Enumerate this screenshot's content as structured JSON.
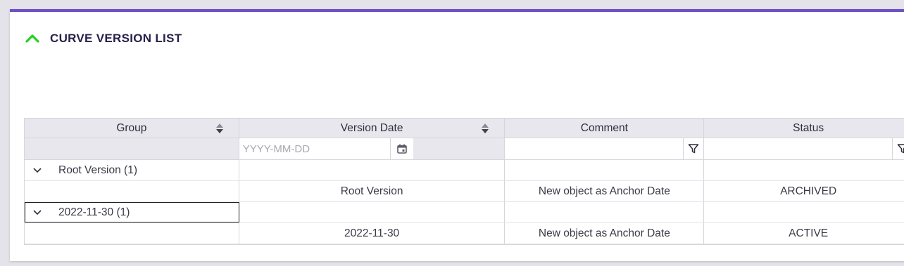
{
  "panel": {
    "title": "CURVE VERSION LIST",
    "accent_color": "#6f4fc7",
    "collapse_icon_color": "#22d21f"
  },
  "grid": {
    "columns": [
      {
        "label": "Group",
        "sortable": true
      },
      {
        "label": "Version Date",
        "sortable": true
      },
      {
        "label": "Comment",
        "sortable": false
      },
      {
        "label": "Status",
        "sortable": false
      }
    ],
    "filters": {
      "version_date_placeholder": "YYYY-MM-DD",
      "version_date_value": "",
      "comment_value": "",
      "status_value": ""
    },
    "groups": [
      {
        "label": "Root Version (1)",
        "expanded": true,
        "rows": [
          {
            "version_date": "Root Version",
            "comment": "New object as Anchor Date",
            "status": "ARCHIVED"
          }
        ]
      },
      {
        "label": "2022-11-30 (1)",
        "expanded": true,
        "focused": true,
        "rows": [
          {
            "version_date": "2022-11-30",
            "comment": "New object as Anchor Date",
            "status": "ACTIVE"
          }
        ]
      }
    ]
  }
}
